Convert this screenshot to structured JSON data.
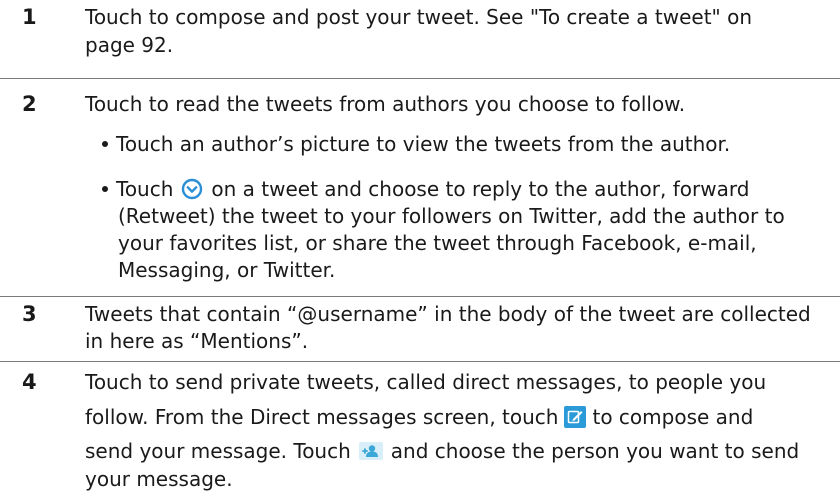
{
  "rows": [
    {
      "number": "1",
      "lines": [
        "Touch to compose and post your tweet. See \"To create a tweet\" on",
        "page 92."
      ]
    },
    {
      "number": "2",
      "intro": "Touch to read the tweets from authors you choose to follow.",
      "bullet1": "Touch an author’s picture to view the tweets from the author.",
      "bullet2_before_icon": "Touch",
      "bullet2_after_icon": "on a tweet and choose to reply to the author, forward",
      "bullet2_cont": [
        "(Retweet) the tweet to your followers on Twitter, add the author to",
        "your favorites list, or share the tweet through Facebook, e-mail,",
        "Messaging, or Twitter."
      ]
    },
    {
      "number": "3",
      "lines": [
        "Tweets that contain “@username” in the body of the tweet are collected",
        "in here as “Mentions”."
      ]
    },
    {
      "number": "4",
      "line1": "Touch to send private tweets, called direct messages, to people you",
      "line2_before_icon": "follow. From the Direct messages screen, touch",
      "line2_after_icon": "to compose and",
      "line3_before_icon": "send your message. Touch",
      "line3_after_icon": "and choose the person you want to send",
      "line4": "your message."
    }
  ],
  "icons": {
    "expand": "chevron-circle-down-icon",
    "compose": "compose-icon",
    "people": "contacts-icon"
  },
  "colors": {
    "expand_icon": "#2b8fd6",
    "compose_icon": "#2a9ad9",
    "people_icon": "#3aa7d8",
    "divider": "#7a7a7a",
    "text": "#1a1a1a"
  }
}
